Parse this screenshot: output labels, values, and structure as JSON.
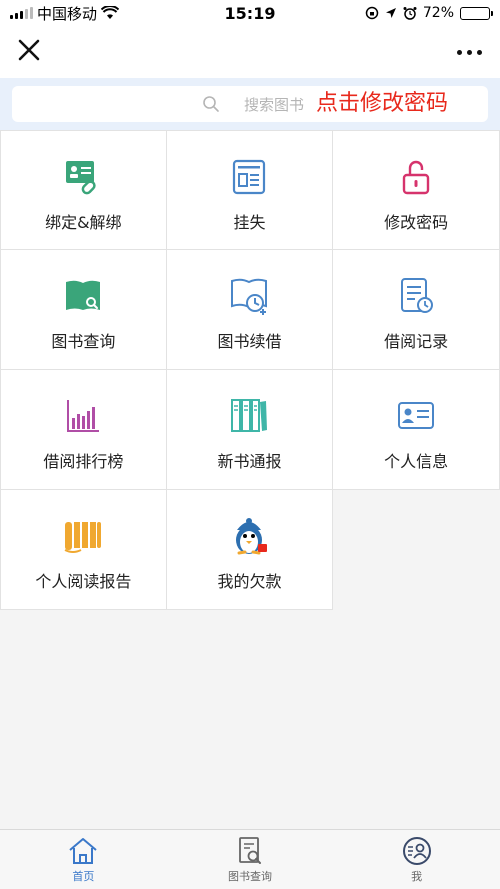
{
  "status_bar": {
    "carrier": "中国移动",
    "time": "15:19",
    "battery_percent": "72%",
    "battery_level": 0.72
  },
  "nav": {
    "close_icon": "close-icon",
    "more_icon": "more-icon"
  },
  "search": {
    "placeholder": "搜索图书"
  },
  "annotation": {
    "text": "点击修改密码",
    "color": "#e8291c"
  },
  "grid": [
    {
      "label": "绑定&解绑",
      "icon": "id-card-link-icon",
      "color": "#3aa57a"
    },
    {
      "label": "挂失",
      "icon": "report-loss-icon",
      "color": "#4a86c8"
    },
    {
      "label": "修改密码",
      "icon": "unlock-icon",
      "color": "#d6336c"
    },
    {
      "label": "图书查询",
      "icon": "book-search-icon",
      "color": "#3aa57a"
    },
    {
      "label": "图书续借",
      "icon": "book-renew-icon",
      "color": "#4a86c8"
    },
    {
      "label": "借阅记录",
      "icon": "document-clock-icon",
      "color": "#4a86c8"
    },
    {
      "label": "借阅排行榜",
      "icon": "bar-chart-icon",
      "color": "#b04ea6"
    },
    {
      "label": "新书通报",
      "icon": "books-icon",
      "color": "#3fb6a8"
    },
    {
      "label": "个人信息",
      "icon": "profile-card-icon",
      "color": "#4a86c8"
    },
    {
      "label": "个人阅读报告",
      "icon": "scroll-icon",
      "color": "#f0a830"
    },
    {
      "label": "我的欠款",
      "icon": "penguin-icon",
      "color": "#2d6fb0"
    }
  ],
  "tabbar": {
    "items": [
      {
        "label": "首页",
        "icon": "home-icon",
        "active": true
      },
      {
        "label": "图书查询",
        "icon": "book-search-icon",
        "active": false
      },
      {
        "label": "我",
        "icon": "user-circle-icon",
        "active": false
      }
    ],
    "active_color": "#3a78c9"
  }
}
